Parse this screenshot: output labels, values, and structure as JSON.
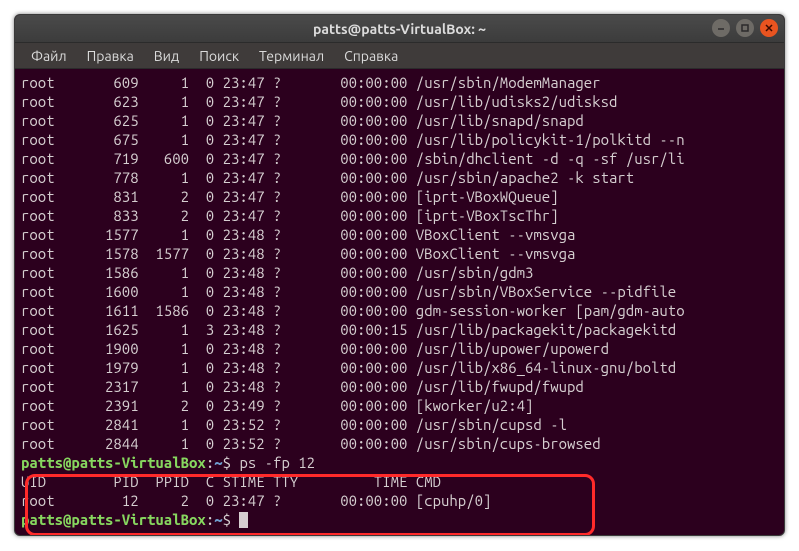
{
  "window": {
    "title": "patts@patts-VirtualBox: ~"
  },
  "menubar": {
    "items": [
      "Файл",
      "Правка",
      "Вид",
      "Поиск",
      "Терминал",
      "Справка"
    ]
  },
  "ps_rows": [
    {
      "uid": "root",
      "pid": "609",
      "ppid": "1",
      "c": "0",
      "stime": "23:47",
      "tty": "?",
      "time": "00:00:00",
      "cmd": "/usr/sbin/ModemManager"
    },
    {
      "uid": "root",
      "pid": "623",
      "ppid": "1",
      "c": "0",
      "stime": "23:47",
      "tty": "?",
      "time": "00:00:00",
      "cmd": "/usr/lib/udisks2/udisksd"
    },
    {
      "uid": "root",
      "pid": "625",
      "ppid": "1",
      "c": "0",
      "stime": "23:47",
      "tty": "?",
      "time": "00:00:00",
      "cmd": "/usr/lib/snapd/snapd"
    },
    {
      "uid": "root",
      "pid": "675",
      "ppid": "1",
      "c": "0",
      "stime": "23:47",
      "tty": "?",
      "time": "00:00:00",
      "cmd": "/usr/lib/policykit-1/polkitd --n"
    },
    {
      "uid": "root",
      "pid": "719",
      "ppid": "600",
      "c": "0",
      "stime": "23:47",
      "tty": "?",
      "time": "00:00:00",
      "cmd": "/sbin/dhclient -d -q -sf /usr/li"
    },
    {
      "uid": "root",
      "pid": "778",
      "ppid": "1",
      "c": "0",
      "stime": "23:47",
      "tty": "?",
      "time": "00:00:00",
      "cmd": "/usr/sbin/apache2 -k start"
    },
    {
      "uid": "root",
      "pid": "831",
      "ppid": "2",
      "c": "0",
      "stime": "23:47",
      "tty": "?",
      "time": "00:00:00",
      "cmd": "[iprt-VBoxWQueue]"
    },
    {
      "uid": "root",
      "pid": "833",
      "ppid": "2",
      "c": "0",
      "stime": "23:47",
      "tty": "?",
      "time": "00:00:00",
      "cmd": "[iprt-VBoxTscThr]"
    },
    {
      "uid": "root",
      "pid": "1577",
      "ppid": "1",
      "c": "0",
      "stime": "23:48",
      "tty": "?",
      "time": "00:00:00",
      "cmd": "VBoxClient --vmsvga"
    },
    {
      "uid": "root",
      "pid": "1578",
      "ppid": "1577",
      "c": "0",
      "stime": "23:48",
      "tty": "?",
      "time": "00:00:00",
      "cmd": "VBoxClient --vmsvga"
    },
    {
      "uid": "root",
      "pid": "1586",
      "ppid": "1",
      "c": "0",
      "stime": "23:48",
      "tty": "?",
      "time": "00:00:00",
      "cmd": "/usr/sbin/gdm3"
    },
    {
      "uid": "root",
      "pid": "1600",
      "ppid": "1",
      "c": "0",
      "stime": "23:48",
      "tty": "?",
      "time": "00:00:00",
      "cmd": "/usr/sbin/VBoxService --pidfile"
    },
    {
      "uid": "root",
      "pid": "1611",
      "ppid": "1586",
      "c": "0",
      "stime": "23:48",
      "tty": "?",
      "time": "00:00:00",
      "cmd": "gdm-session-worker [pam/gdm-auto"
    },
    {
      "uid": "root",
      "pid": "1625",
      "ppid": "1",
      "c": "3",
      "stime": "23:48",
      "tty": "?",
      "time": "00:00:15",
      "cmd": "/usr/lib/packagekit/packagekitd"
    },
    {
      "uid": "root",
      "pid": "1900",
      "ppid": "1",
      "c": "0",
      "stime": "23:48",
      "tty": "?",
      "time": "00:00:00",
      "cmd": "/usr/lib/upower/upowerd"
    },
    {
      "uid": "root",
      "pid": "1979",
      "ppid": "1",
      "c": "0",
      "stime": "23:48",
      "tty": "?",
      "time": "00:00:00",
      "cmd": "/usr/lib/x86_64-linux-gnu/boltd"
    },
    {
      "uid": "root",
      "pid": "2317",
      "ppid": "1",
      "c": "0",
      "stime": "23:48",
      "tty": "?",
      "time": "00:00:00",
      "cmd": "/usr/lib/fwupd/fwupd"
    },
    {
      "uid": "root",
      "pid": "2391",
      "ppid": "2",
      "c": "0",
      "stime": "23:49",
      "tty": "?",
      "time": "00:00:00",
      "cmd": "[kworker/u2:4]"
    },
    {
      "uid": "root",
      "pid": "2841",
      "ppid": "1",
      "c": "0",
      "stime": "23:52",
      "tty": "?",
      "time": "00:00:00",
      "cmd": "/usr/sbin/cupsd -l"
    },
    {
      "uid": "root",
      "pid": "2844",
      "ppid": "1",
      "c": "0",
      "stime": "23:52",
      "tty": "?",
      "time": "00:00:00",
      "cmd": "/usr/sbin/cups-browsed"
    }
  ],
  "prompt": {
    "user_host": "patts@patts-VirtualBox",
    "colon": ":",
    "path": "~",
    "dollar": "$"
  },
  "command1": "ps -fp 12",
  "header": {
    "uid": "UID",
    "pid": "PID",
    "ppid": "PPID",
    "c": "C",
    "stime": "STIME",
    "tty": "TTY",
    "time": "TIME",
    "cmd": "CMD"
  },
  "result_row": {
    "uid": "root",
    "pid": "12",
    "ppid": "2",
    "c": "0",
    "stime": "23:47",
    "tty": "?",
    "time": "00:00:00",
    "cmd": "[cpuhp/0]"
  }
}
